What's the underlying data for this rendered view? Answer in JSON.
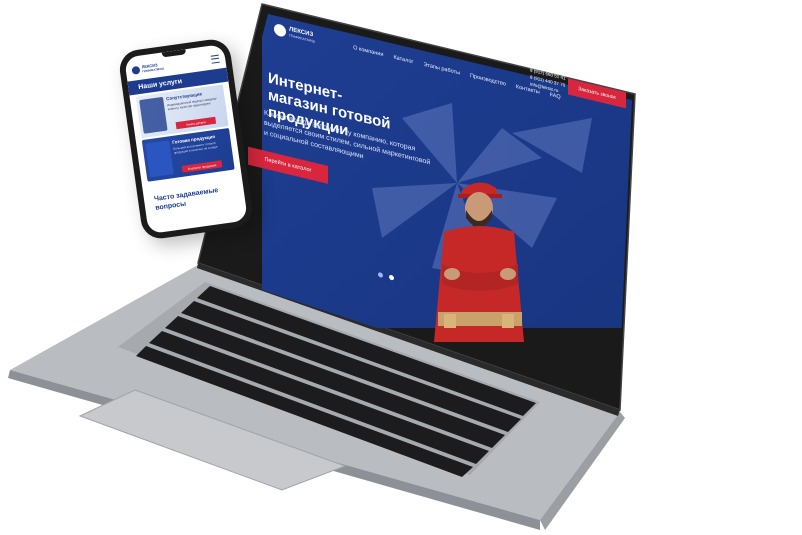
{
  "site": {
    "logo_title": "ЛЕКСИЗ",
    "logo_subtitle": "ГРАФИКАТМАШ",
    "nav": [
      "О компании",
      "Каталог",
      "Этапы работы",
      "Производство",
      "Контакты",
      "FAQ"
    ],
    "hero_title": "Интернет-магазин готовой продукции",
    "hero_text": "Клиент всегда запомнит ту компанию, которая выделяется своим стилем, сильной маркетинговой и социальной составляющими",
    "cta_label": "Перейти в каталог",
    "phones": [
      "8 (912) 660 51 41",
      "8 (911) 440 37 70",
      "info@leksiz.ru"
    ],
    "order_label": "Заказать звонок",
    "slider_dots": 2,
    "slider_active": 1
  },
  "phone": {
    "logo_title": "ЛЕКСИЗ",
    "logo_subtitle": "ГРАФИКАТМАШ",
    "section_title": "Наши услуги",
    "card1_title": "Сопутствующие",
    "card1_text": "Индивидуальный подход к каждому клиенту, качество гарантируем",
    "card1_btn": "Узнать детали",
    "card2_title": "Готовая продукция",
    "card2_text": "Большой ассортимент готовой продукции в наличии на складе",
    "card2_btn": "В каталог продукции",
    "faq_title": "Часто задаваемые вопросы"
  },
  "colors": {
    "brand_blue": "#1d3c8f",
    "accent_red": "#d7263d"
  }
}
